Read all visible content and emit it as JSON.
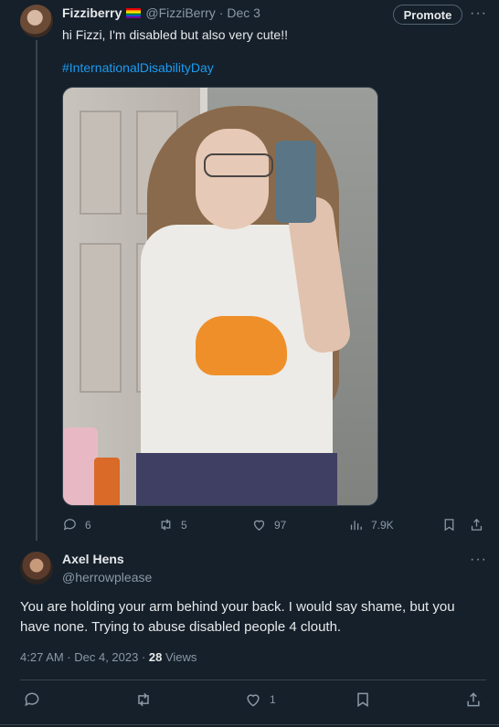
{
  "tweet": {
    "author_name": "Fizziberry",
    "author_handle": "@FizziBerry",
    "date": "· Dec 3",
    "promote_label": "Promote",
    "more_label": "···",
    "text": "hi Fizzi, I'm disabled but also very cute!!",
    "hashtag": "#InternationalDisabilityDay",
    "stats": {
      "replies": "6",
      "retweets": "5",
      "likes": "97",
      "views": "7.9K"
    }
  },
  "reply": {
    "author_name": "Axel Hens",
    "author_handle": "@herrowplease",
    "more_label": "···",
    "text": "You are holding your arm behind your back. I would say shame, but you have none. Trying to abuse disabled people 4 clouth.",
    "timestamp": "4:27 AM · Dec 4, 2023 · ",
    "view_count": "28",
    "views_label": " Views",
    "stats": {
      "likes": "1"
    }
  },
  "colors": {
    "background": "#15202b",
    "accent": "#1d9bf0",
    "muted": "#8b98a5"
  }
}
